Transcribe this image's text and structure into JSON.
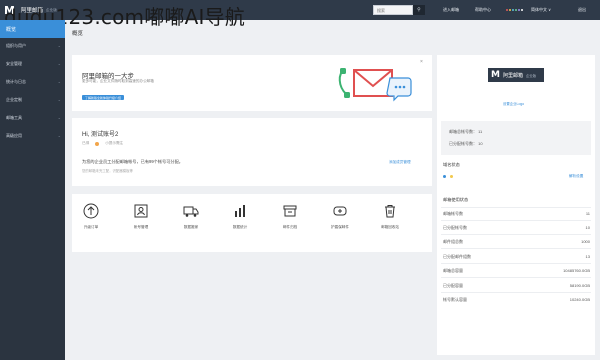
{
  "header": {
    "brand": "阿里邮箱",
    "brand_tag": "企业版",
    "watermark": "dudu123.com嘟嘟AI导航",
    "search_placeholder": "搜索",
    "search_icon": "search-icon",
    "nav": [
      "进入邮箱",
      "帮助中心",
      "简体中文 ∨",
      "退出"
    ]
  },
  "sidebar": {
    "home": "概览",
    "items": [
      "组织与用户",
      "安全管理",
      "统计与日志",
      "企业定制",
      "邮箱工具",
      "高级应用"
    ]
  },
  "breadcrumb": "概览",
  "banner": {
    "title": "阿里邮箱的一大步",
    "subtitle": "更多可能，企业文件随时取到高速的办公邮箱",
    "button": "了解新版全新体验升级介绍",
    "close": "×"
  },
  "welcome": {
    "greeting": "Hi, 测试账号2",
    "status": "已绑",
    "status_note": "小提示需注",
    "info": "为您的企业员工分配邮箱帐号，已有99个帐号可分配。",
    "info_sub": "您的邮箱未完工配，识配器模板等",
    "action_link": "添加成员管理"
  },
  "tools": [
    {
      "label": "升级订单",
      "icon": "arrow-up-circle-icon"
    },
    {
      "label": "帐号管理",
      "icon": "user-card-icon"
    },
    {
      "label": "数据搬家",
      "icon": "truck-icon"
    },
    {
      "label": "数据统计",
      "icon": "bar-chart-icon"
    },
    {
      "label": "邮件归档",
      "icon": "archive-box-icon"
    },
    {
      "label": "护盾保邮件",
      "icon": "shield-mail-icon"
    },
    {
      "label": "邮箱回收站",
      "icon": "trash-icon"
    }
  ],
  "right": {
    "logo_text": "阿里邮箱",
    "logo_tag": "企业版",
    "logo_link": "设置企业Logo",
    "stats": [
      {
        "label": "邮箱总帐号数：",
        "value": "11"
      },
      {
        "label": "已分配帐号数：",
        "value": "10"
      }
    ],
    "domain_title": "域名状态",
    "domain_link": "解析设置",
    "usage_title": "邮箱使用状态",
    "usage": [
      {
        "label": "邮箱帐号数",
        "value": "11"
      },
      {
        "label": "已分配帐号数",
        "value": "10"
      },
      {
        "label": "邮件组总数",
        "value": "1000"
      },
      {
        "label": "已分配邮件组数",
        "value": "13"
      },
      {
        "label": "邮箱总容量",
        "value": "10485760.0GB"
      },
      {
        "label": "已分配容量",
        "value": "58190.0GB"
      },
      {
        "label": "帐号默认容量",
        "value": "10240.0GB"
      }
    ]
  },
  "colors": {
    "topbar": "#2f3a49",
    "sidebar": "#2b3440",
    "accent": "#3a8fd9",
    "mail_red": "#e05050",
    "phone_green": "#3cb371"
  }
}
